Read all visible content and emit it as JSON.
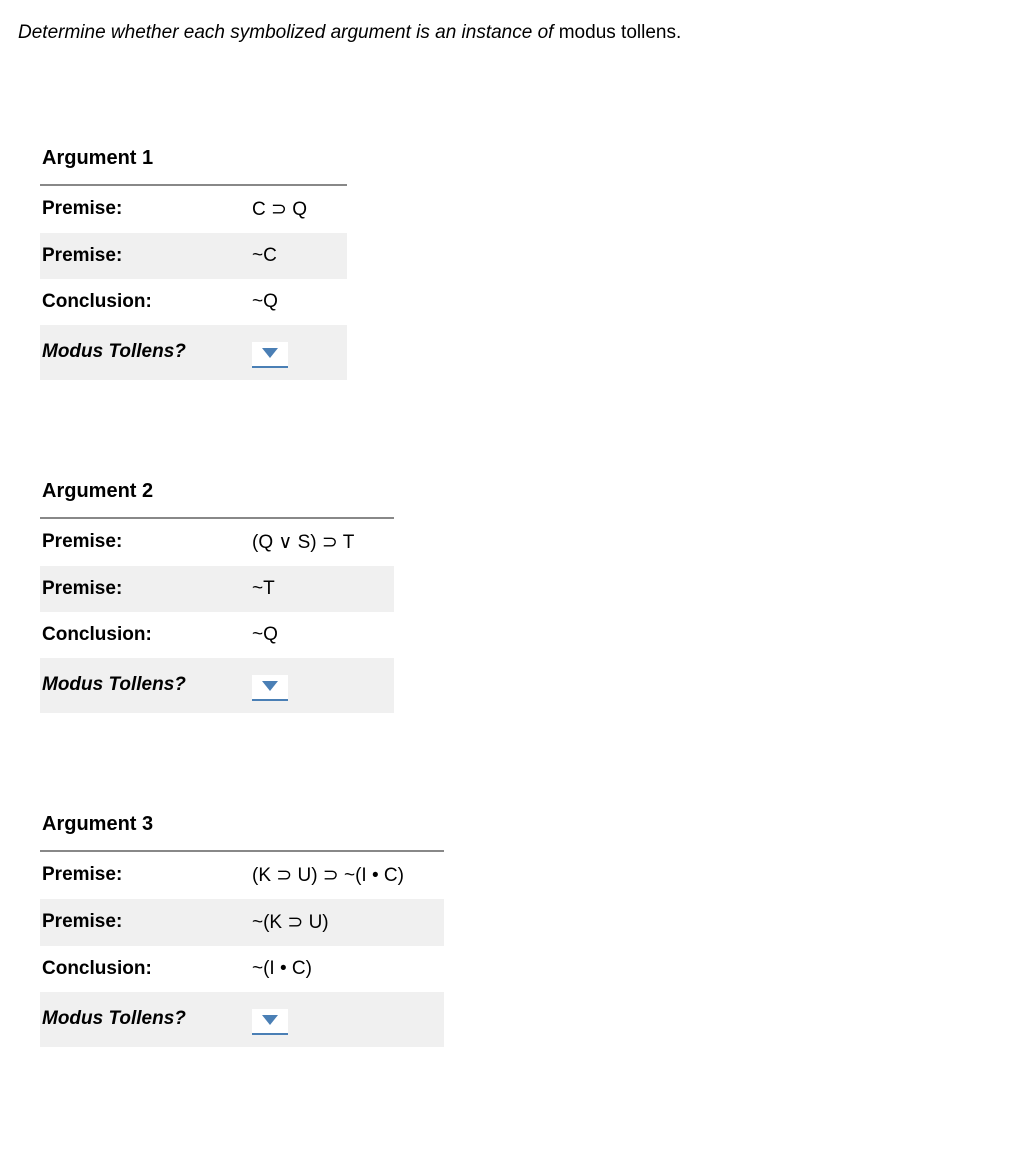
{
  "instructions": {
    "italic_part": "Determine whether each symbolized argument is an instance of ",
    "normal_part": "modus tollens."
  },
  "labels": {
    "premise": "Premise:",
    "conclusion": "Conclusion:",
    "modus_tollens": "Modus Tollens?"
  },
  "arguments": [
    {
      "title": "Argument 1",
      "premise1": "C ⊃ Q",
      "premise2": "~C",
      "conclusion": "~Q",
      "selected": ""
    },
    {
      "title": "Argument 2",
      "premise1": "(Q ∨ S) ⊃ T",
      "premise2": "~T",
      "conclusion": "~Q",
      "selected": ""
    },
    {
      "title": "Argument 3",
      "premise1": "(K ⊃ U) ⊃ ~(I • C)",
      "premise2": "~(K ⊃ U)",
      "conclusion": "~(I • C)",
      "selected": ""
    }
  ]
}
